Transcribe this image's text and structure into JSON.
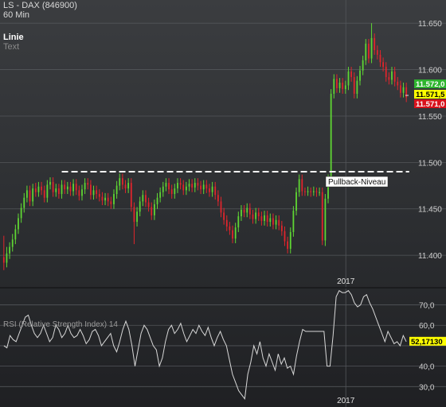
{
  "header": {
    "title": "LS - DAX (846900)",
    "interval": "60 Min",
    "tool_name": "Linie",
    "tool_text": "Text"
  },
  "colors": {
    "up": "#5fd633",
    "down": "#e0252c",
    "grid": "#53565a",
    "rsi_line": "#d8d8d8",
    "level_line": "#f2f2f2",
    "badge_green": "#2fb52f",
    "badge_yellow": "#ffff00",
    "badge_red": "#d8121c"
  },
  "chart_data": [
    {
      "type": "candlestick",
      "x_label": "2017",
      "ylim": [
        11365,
        11675
      ],
      "y_ticks": [
        {
          "value": 11400,
          "label": "11.400"
        },
        {
          "value": 11450,
          "label": "11.450"
        },
        {
          "value": 11500,
          "label": "11.500"
        },
        {
          "value": 11550,
          "label": "11.550"
        },
        {
          "value": 11600,
          "label": "11.600"
        },
        {
          "value": 11650,
          "label": "11.650"
        }
      ],
      "grid": true,
      "x_count": 140,
      "year_boundary_index": 117,
      "candles": [
        [
          0,
          11398,
          11392,
          11421,
          11384
        ],
        [
          1,
          11392,
          11402,
          11409,
          11387
        ],
        [
          2,
          11402,
          11409,
          11414,
          11396
        ],
        [
          3,
          11409,
          11417,
          11423,
          11404
        ],
        [
          4,
          11417,
          11428,
          11433,
          11412
        ],
        [
          5,
          11428,
          11440,
          11445,
          11423
        ],
        [
          6,
          11440,
          11451,
          11456,
          11435
        ],
        [
          7,
          11451,
          11462,
          11467,
          11446
        ],
        [
          8,
          11462,
          11470,
          11475,
          11457
        ],
        [
          9,
          11470,
          11458,
          11475,
          11453
        ],
        [
          10,
          11458,
          11472,
          11477,
          11453
        ],
        [
          11,
          11472,
          11468,
          11478,
          11463
        ],
        [
          12,
          11468,
          11474,
          11479,
          11463
        ],
        [
          13,
          11474,
          11470,
          11479,
          11465
        ],
        [
          14,
          11470,
          11462,
          11475,
          11457
        ],
        [
          15,
          11462,
          11476,
          11481,
          11457
        ],
        [
          16,
          11476,
          11479,
          11484,
          11471
        ],
        [
          17,
          11479,
          11468,
          11484,
          11463
        ],
        [
          18,
          11468,
          11472,
          11477,
          11463
        ],
        [
          19,
          11472,
          11466,
          11477,
          11461
        ],
        [
          20,
          11466,
          11476,
          11481,
          11461
        ],
        [
          21,
          11476,
          11471,
          11481,
          11466
        ],
        [
          22,
          11471,
          11474,
          11479,
          11466
        ],
        [
          23,
          11474,
          11469,
          11479,
          11464
        ],
        [
          24,
          11469,
          11477,
          11482,
          11464
        ],
        [
          25,
          11477,
          11470,
          11482,
          11465
        ],
        [
          26,
          11470,
          11464,
          11475,
          11459
        ],
        [
          27,
          11464,
          11471,
          11476,
          11459
        ],
        [
          28,
          11471,
          11478,
          11483,
          11466
        ],
        [
          29,
          11478,
          11476,
          11483,
          11471
        ],
        [
          30,
          11476,
          11465,
          11481,
          11460
        ],
        [
          31,
          11465,
          11470,
          11475,
          11460
        ],
        [
          32,
          11470,
          11466,
          11475,
          11461
        ],
        [
          33,
          11466,
          11463,
          11471,
          11458
        ],
        [
          34,
          11463,
          11459,
          11468,
          11454
        ],
        [
          35,
          11459,
          11462,
          11467,
          11454
        ],
        [
          36,
          11462,
          11458,
          11467,
          11453
        ],
        [
          37,
          11458,
          11455,
          11463,
          11450
        ],
        [
          38,
          11455,
          11466,
          11471,
          11450
        ],
        [
          39,
          11466,
          11475,
          11480,
          11461
        ],
        [
          40,
          11475,
          11483,
          11488,
          11470
        ],
        [
          41,
          11483,
          11476,
          11488,
          11471
        ],
        [
          42,
          11476,
          11472,
          11481,
          11467
        ],
        [
          43,
          11472,
          11478,
          11483,
          11467
        ],
        [
          44,
          11478,
          11452,
          11483,
          11447
        ],
        [
          45,
          11452,
          11436,
          11457,
          11412
        ],
        [
          46,
          11436,
          11447,
          11452,
          11431
        ],
        [
          47,
          11447,
          11458,
          11463,
          11442
        ],
        [
          48,
          11458,
          11465,
          11470,
          11453
        ],
        [
          49,
          11465,
          11457,
          11470,
          11452
        ],
        [
          50,
          11457,
          11452,
          11462,
          11447
        ],
        [
          51,
          11452,
          11443,
          11457,
          11438
        ],
        [
          52,
          11443,
          11455,
          11460,
          11438
        ],
        [
          53,
          11455,
          11462,
          11467,
          11450
        ],
        [
          54,
          11462,
          11468,
          11473,
          11457
        ],
        [
          55,
          11468,
          11474,
          11479,
          11463
        ],
        [
          56,
          11474,
          11478,
          11483,
          11469
        ],
        [
          57,
          11478,
          11471,
          11483,
          11466
        ],
        [
          58,
          11471,
          11466,
          11476,
          11461
        ],
        [
          59,
          11466,
          11472,
          11477,
          11461
        ],
        [
          60,
          11472,
          11478,
          11483,
          11467
        ],
        [
          61,
          11478,
          11476,
          11483,
          11471
        ],
        [
          62,
          11476,
          11470,
          11481,
          11465
        ],
        [
          63,
          11470,
          11474,
          11479,
          11465
        ],
        [
          64,
          11474,
          11477,
          11482,
          11469
        ],
        [
          65,
          11477,
          11473,
          11482,
          11468
        ],
        [
          66,
          11473,
          11478,
          11483,
          11468
        ],
        [
          67,
          11478,
          11475,
          11483,
          11470
        ],
        [
          68,
          11475,
          11471,
          11480,
          11466
        ],
        [
          69,
          11471,
          11476,
          11481,
          11466
        ],
        [
          70,
          11476,
          11472,
          11481,
          11467
        ],
        [
          71,
          11472,
          11468,
          11477,
          11463
        ],
        [
          72,
          11468,
          11474,
          11479,
          11463
        ],
        [
          73,
          11474,
          11465,
          11479,
          11460
        ],
        [
          74,
          11465,
          11458,
          11470,
          11453
        ],
        [
          75,
          11458,
          11446,
          11463,
          11441
        ],
        [
          76,
          11446,
          11438,
          11451,
          11433
        ],
        [
          77,
          11438,
          11431,
          11443,
          11426
        ],
        [
          78,
          11431,
          11427,
          11436,
          11422
        ],
        [
          79,
          11427,
          11418,
          11432,
          11413
        ],
        [
          80,
          11418,
          11430,
          11435,
          11413
        ],
        [
          81,
          11430,
          11442,
          11447,
          11425
        ],
        [
          82,
          11442,
          11449,
          11454,
          11437
        ],
        [
          83,
          11449,
          11446,
          11454,
          11441
        ],
        [
          84,
          11446,
          11451,
          11456,
          11441
        ],
        [
          85,
          11451,
          11444,
          11456,
          11439
        ],
        [
          86,
          11444,
          11439,
          11449,
          11434
        ],
        [
          87,
          11439,
          11446,
          11451,
          11434
        ],
        [
          88,
          11446,
          11442,
          11451,
          11437
        ],
        [
          89,
          11442,
          11437,
          11447,
          11432
        ],
        [
          90,
          11437,
          11443,
          11448,
          11432
        ],
        [
          91,
          11443,
          11436,
          11448,
          11431
        ],
        [
          92,
          11436,
          11440,
          11445,
          11431
        ],
        [
          93,
          11440,
          11433,
          11445,
          11428
        ],
        [
          94,
          11433,
          11438,
          11443,
          11428
        ],
        [
          95,
          11438,
          11432,
          11443,
          11427
        ],
        [
          96,
          11432,
          11426,
          11437,
          11421
        ],
        [
          97,
          11426,
          11415,
          11431,
          11410
        ],
        [
          98,
          11415,
          11407,
          11420,
          11402
        ],
        [
          99,
          11407,
          11425,
          11430,
          11402
        ],
        [
          100,
          11425,
          11448,
          11453,
          11420
        ],
        [
          101,
          11448,
          11468,
          11473,
          11443
        ],
        [
          102,
          11468,
          11482,
          11487,
          11463
        ],
        [
          103,
          11482,
          11469,
          11487,
          11464
        ],
        [
          104,
          11469,
          11468,
          11473,
          11464
        ],
        [
          105,
          11468,
          11469,
          11474,
          11464
        ],
        [
          106,
          11469,
          11468,
          11473,
          11463
        ],
        [
          107,
          11468,
          11469,
          11474,
          11464
        ],
        [
          108,
          11469,
          11468,
          11473,
          11463
        ],
        [
          109,
          11468,
          11468,
          11473,
          11464
        ],
        [
          110,
          11468,
          11416,
          11473,
          11411
        ],
        [
          111,
          11416,
          11461,
          11466,
          11410
        ],
        [
          112,
          11461,
          11482,
          11487,
          11456
        ],
        [
          113,
          11482,
          11574,
          11579,
          11477
        ],
        [
          114,
          11574,
          11590,
          11595,
          11569
        ],
        [
          115,
          11590,
          11580,
          11595,
          11575
        ],
        [
          116,
          11580,
          11586,
          11591,
          11575
        ],
        [
          117,
          11586,
          11579,
          11591,
          11574
        ],
        [
          118,
          11579,
          11583,
          11588,
          11574
        ],
        [
          119,
          11583,
          11598,
          11603,
          11578
        ],
        [
          120,
          11598,
          11592,
          11603,
          11587
        ],
        [
          121,
          11592,
          11574,
          11597,
          11569
        ],
        [
          122,
          11574,
          11588,
          11593,
          11569
        ],
        [
          123,
          11588,
          11599,
          11604,
          11583
        ],
        [
          124,
          11599,
          11610,
          11615,
          11594
        ],
        [
          125,
          11610,
          11628,
          11633,
          11605
        ],
        [
          126,
          11628,
          11612,
          11633,
          11607
        ],
        [
          127,
          11612,
          11634,
          11650,
          11607
        ],
        [
          128,
          11634,
          11621,
          11639,
          11616
        ],
        [
          129,
          11621,
          11616,
          11626,
          11611
        ],
        [
          130,
          11616,
          11608,
          11621,
          11603
        ],
        [
          131,
          11608,
          11603,
          11613,
          11598
        ],
        [
          132,
          11603,
          11592,
          11608,
          11587
        ],
        [
          133,
          11592,
          11589,
          11597,
          11584
        ],
        [
          134,
          11589,
          11598,
          11603,
          11584
        ],
        [
          135,
          11598,
          11587,
          11603,
          11582
        ],
        [
          136,
          11587,
          11583,
          11592,
          11578
        ],
        [
          137,
          11583,
          11575,
          11588,
          11570
        ],
        [
          138,
          11575,
          11581,
          11586,
          11570
        ],
        [
          139,
          11581,
          11570,
          11586,
          11565
        ]
      ],
      "horizontal_line": {
        "value": 11490,
        "style": "dashed",
        "label": "Pullback-Niveau"
      },
      "price_badges": [
        {
          "label": "11.572,0",
          "color_key": "badge_green"
        },
        {
          "label": "11.571,5",
          "color_key": "badge_yellow"
        },
        {
          "label": "11.571,0",
          "color_key": "badge_red"
        }
      ]
    },
    {
      "type": "line",
      "title": "RSI (Relative Strength Index) 14",
      "x_label": "2017",
      "ylim": [
        20,
        78
      ],
      "y_ticks": [
        {
          "value": 30,
          "label": "30,0"
        },
        {
          "value": 40,
          "label": "40,0"
        },
        {
          "value": 50,
          "label": ""
        },
        {
          "value": 60,
          "label": "60,0"
        },
        {
          "value": 70,
          "label": "70,0"
        }
      ],
      "grid": true,
      "last_value_label": "52,17130",
      "values": [
        50,
        49,
        55,
        53,
        52,
        56,
        60,
        64,
        65,
        60,
        56,
        54,
        56,
        60,
        56,
        52,
        54,
        60,
        58,
        54,
        56,
        60,
        56,
        54,
        55,
        58,
        55,
        51,
        53,
        57,
        58,
        55,
        50,
        52,
        54,
        56,
        50,
        47,
        52,
        58,
        62,
        58,
        50,
        40,
        48,
        56,
        60,
        58,
        54,
        50,
        48,
        40,
        44,
        52,
        58,
        60,
        56,
        58,
        61,
        56,
        52,
        55,
        58,
        56,
        60,
        57,
        55,
        59,
        54,
        50,
        54,
        57,
        53,
        50,
        43,
        36,
        32,
        28,
        26,
        24,
        36,
        42,
        50,
        46,
        52,
        44,
        40,
        46,
        42,
        38,
        46,
        41,
        44,
        39,
        40,
        36,
        45,
        52,
        58,
        57,
        57,
        57,
        57,
        57,
        57,
        57,
        40,
        40,
        55,
        74,
        77,
        76,
        76,
        77,
        75,
        71,
        69,
        70,
        74,
        75,
        71,
        68,
        64,
        60,
        56,
        52,
        57,
        54,
        51,
        52,
        50,
        55,
        52
      ]
    }
  ]
}
